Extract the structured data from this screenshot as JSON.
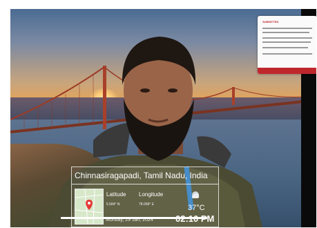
{
  "location_overlay": {
    "place": "Chinnasiragapadi, Tamil Nadu, India",
    "latitude_label": "Latitude",
    "latitude_value": "5.584° N",
    "longitude_label": "Longitude",
    "longitude_value": "78.058° E",
    "date": "Monday, 29 Jan, 2024",
    "temperature": "37°C",
    "time": "02:10 PM",
    "weather_icon": "partly-cloudy-icon"
  },
  "popup": {
    "title": "SUBMITTED"
  },
  "colors": {
    "popup_accent": "#c0272d",
    "overlay_text": "#ffffff"
  }
}
